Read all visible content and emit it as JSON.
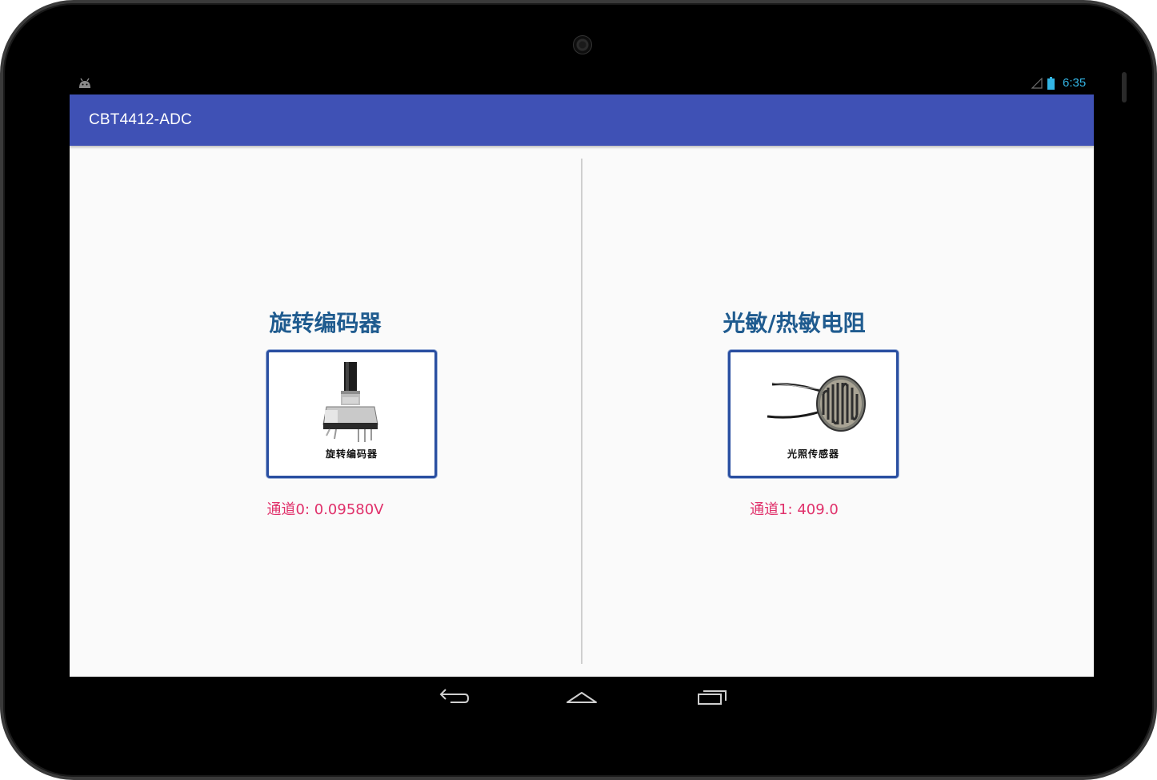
{
  "status_bar": {
    "time": "6:35",
    "icons": [
      "android-debug-icon",
      "signal-icon",
      "battery-icon"
    ]
  },
  "app_bar": {
    "title": "CBT4412-ADC",
    "color": "#3f51b5"
  },
  "panels": [
    {
      "title": "旋转编码器",
      "card_caption": "旋转编码器",
      "reading": "通道0: 0.09580V",
      "image": "rotary-encoder-image"
    },
    {
      "title": "光敏/热敏电阻",
      "card_caption": "光照传感器",
      "reading": "通道1: 409.0",
      "image": "photoresistor-image"
    }
  ],
  "nav_bar": {
    "buttons": [
      "back-icon",
      "home-icon",
      "recents-icon"
    ]
  },
  "colors": {
    "title_text": "#1f5b8f",
    "reading_text": "#e0306a",
    "card_border": "#2a4fa1",
    "clock": "#33b5e5"
  }
}
